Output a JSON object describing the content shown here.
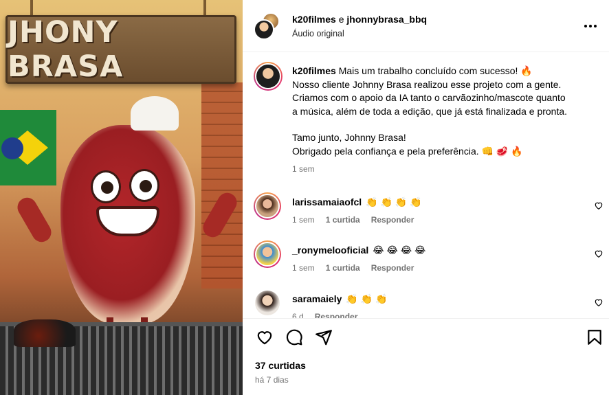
{
  "media": {
    "sign_text": "JHONY BRASA"
  },
  "header": {
    "user1": "k20filmes",
    "connector": " e ",
    "user2": "jhonnybrasa_bbq",
    "subtitle": "Áudio original",
    "more_icon": "more-horizontal-icon"
  },
  "caption": {
    "username": "k20filmes",
    "line1": "Mais um trabalho concluído com sucesso! 🔥",
    "line2": "Nosso cliente Johnny Brasa realizou esse projeto com a gente.",
    "line3": "Criamos com o apoio da IA tanto o carvãozinho/mascote quanto",
    "line4": "a música, além de toda a edição, que já está finalizada e pronta.",
    "line5": "Tamo junto, Johnny Brasa!",
    "line6": "Obrigado pela confiança e pela preferência. 👊 🥩 🔥",
    "time": "1 sem"
  },
  "comments": [
    {
      "username": "larissamaiaofcl",
      "text": "👏 👏 👏 👏",
      "time": "1 sem",
      "likes": "1 curtida",
      "reply": "Responder"
    },
    {
      "username": "_ronymelooficial",
      "text": "😂 😂 😂 😂",
      "time": "1 sem",
      "likes": "1 curtida",
      "reply": "Responder"
    },
    {
      "username": "saramaiely",
      "text": "👏 👏 👏",
      "time": "6 d",
      "reply": "Responder"
    }
  ],
  "actions": {
    "like_icon": "heart-icon",
    "comment_icon": "comment-icon",
    "share_icon": "share-icon",
    "save_icon": "bookmark-icon"
  },
  "footer": {
    "likes": "37 curtidas",
    "date": "há 7 dias"
  }
}
